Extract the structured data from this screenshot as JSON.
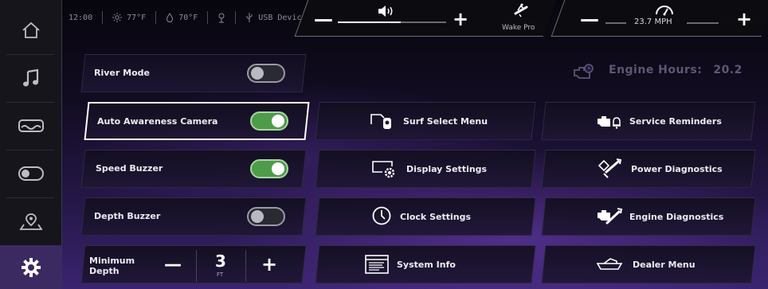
{
  "status_bar": {
    "time": "12:00",
    "outside_temp": "77°F",
    "water_temp": "70°F",
    "usb_label": "USB Device"
  },
  "volume": {
    "minus": "—",
    "plus": "+",
    "level": 0.58
  },
  "profile": {
    "label": "Wake Pro"
  },
  "speed": {
    "minus": "—",
    "plus": "+",
    "value": "23.7 MPH"
  },
  "engine_hours": {
    "label": "Engine Hours:",
    "value": "20.2"
  },
  "settings": {
    "river_mode": {
      "label": "River Mode",
      "on": false
    },
    "auto_camera": {
      "label": "Auto Awareness Camera",
      "on": true
    },
    "speed_buzzer": {
      "label": "Speed Buzzer",
      "on": true
    },
    "depth_buzzer": {
      "label": "Depth Buzzer",
      "on": false
    },
    "min_depth": {
      "label_line1": "Minimum",
      "label_line2": "Depth",
      "minus": "—",
      "value": "3",
      "unit": "FT",
      "plus": "+"
    }
  },
  "menus": {
    "surf_select": "Surf Select Menu",
    "display_settings": "Display Settings",
    "clock_settings": "Clock Settings",
    "system_info": "System Info",
    "service_reminders": "Service Reminders",
    "power_diagnostics": "Power Diagnostics",
    "engine_diagnostics": "Engine Diagnostics",
    "dealer_menu": "Dealer Menu"
  },
  "sidebar": [
    "home-icon",
    "music-icon",
    "boat-icon",
    "toggle-icon",
    "map-pin-icon",
    "settings-gear-icon"
  ],
  "colors": {
    "accent_purple": "#3b2a62",
    "toggle_on": "#4e9b4a",
    "background": "#251747"
  }
}
